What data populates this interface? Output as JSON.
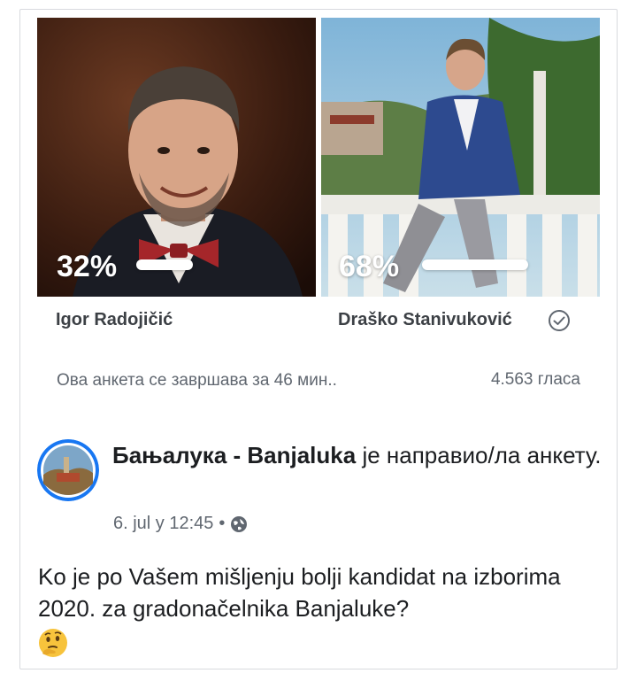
{
  "poll": {
    "options": [
      {
        "name": "Igor Radojičić",
        "percent": "32%",
        "share": 0.32
      },
      {
        "name": "Draško Stanivuković",
        "percent": "68%",
        "share": 0.68
      }
    ],
    "status": "Ова анкета се завршава за 46 мин..",
    "votes": "4.563 гласа",
    "winner_icon": "check-circle-icon"
  },
  "post": {
    "page_name": "Бањалука - Banjaluka",
    "action": " је направио/ла анкету.",
    "date": "6. jul у 12:45",
    "separator": "•",
    "privacy_icon": "globe-icon",
    "text": "Ko je po Vašem mišljenju bolji kandidat na izborima 2020. za gradonačelnika Banjaluke?",
    "emoji": "thinking-face-icon"
  },
  "colors": {
    "text_primary": "#1c1e21",
    "text_secondary": "#606770",
    "border": "#d8dade",
    "avatar_ring": "#1877f2"
  }
}
